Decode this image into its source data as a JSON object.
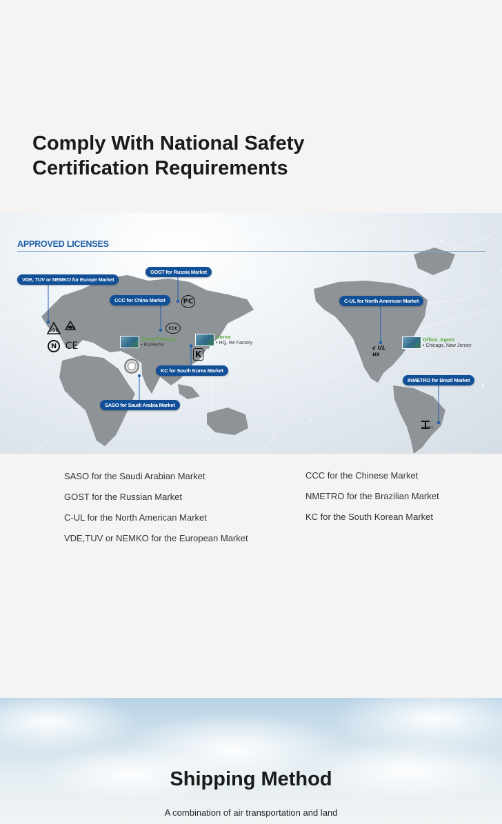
{
  "header": {
    "title_line1": "Comply With National Safety",
    "title_line2": "Certification Requirements"
  },
  "map": {
    "heading": "APPROVED LICENSES",
    "pills": {
      "europe": "VDE, TUV or NEMKO for Europe Market",
      "russia": "GOST for Russia Market",
      "china": "CCC for China Market",
      "south_korea": "KC for South Korea Market",
      "saudi": "SASO for Saudi Arabia Market",
      "north_america": "C-UL for  North American Market",
      "brazil": "INMETRO for Brazil Market"
    },
    "locations": {
      "china_factory_name": "China Factory",
      "china_factory_detail": "• Ro/Re/Sc",
      "korea_name": "Korea",
      "korea_detail": "• HQ, Re Factory",
      "us_office_name": "Office, Agent",
      "us_office_detail": "• Chicago, New Jersey"
    },
    "marks": {
      "tuv": "TUV",
      "ce": "CE",
      "nemko": "N",
      "gost": "PC",
      "ccc": "CCC",
      "kc": "K",
      "cul": "c UL us",
      "inmetro": "INMETRO"
    },
    "colors": {
      "pill_bg": "#114f96",
      "heading": "#1d5ea8",
      "factory_label": "#5aa83a",
      "land": "#8e9398"
    }
  },
  "licenses": {
    "left": [
      "SASO for the Saudi Arabian Market",
      "GOST for the Russian Market",
      "C-UL for the North American Market",
      "VDE,TUV or NEMKO for the European Market"
    ],
    "right": [
      "CCC for the Chinese Market",
      "NMETRO for the Brazilian Market",
      "KC for the South Korean Market"
    ]
  },
  "shipping": {
    "title": "Shipping Method",
    "subtitle": "A combination of air transportation and land"
  }
}
